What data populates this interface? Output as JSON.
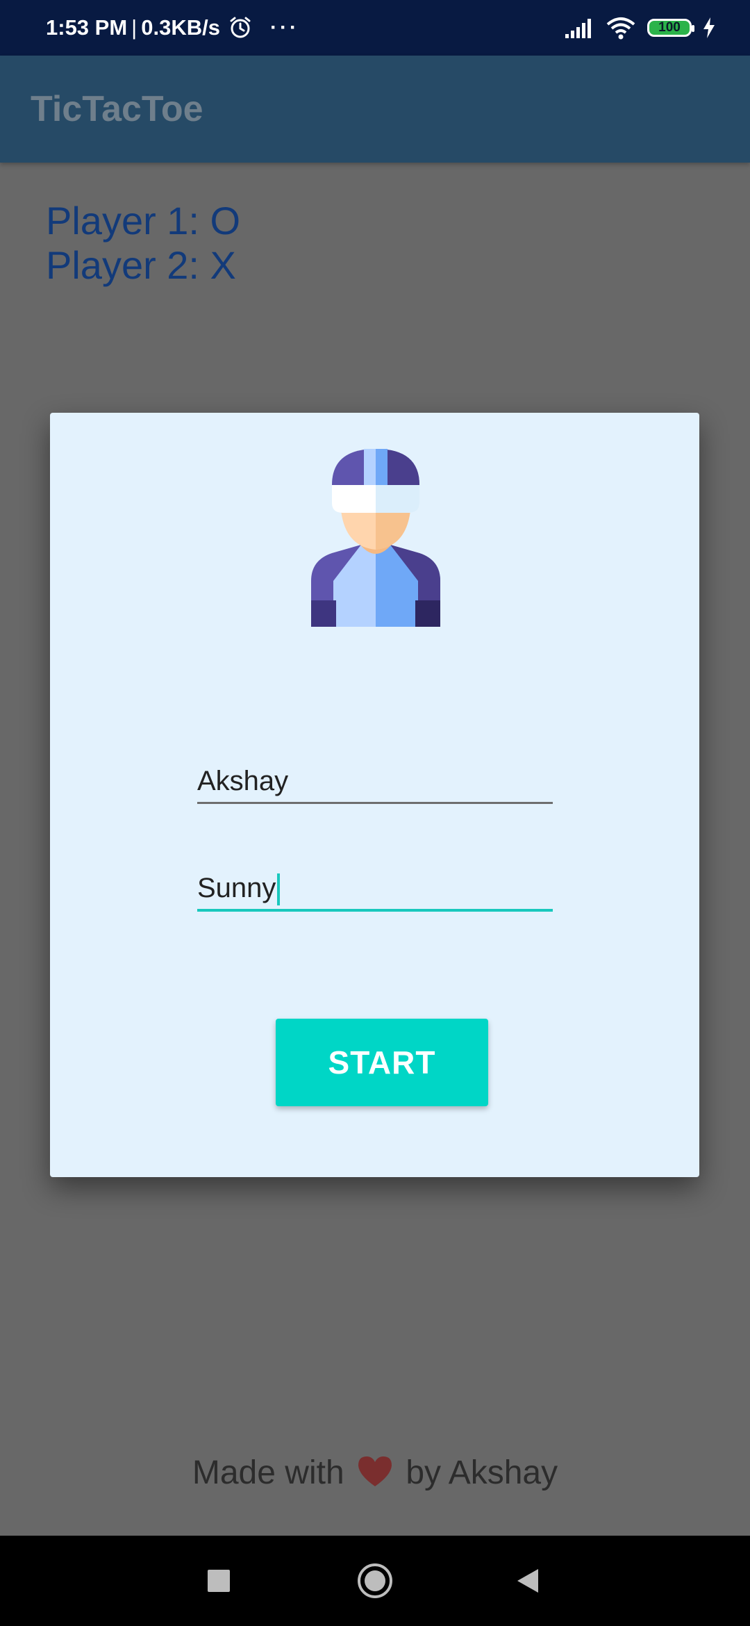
{
  "status_bar": {
    "time": "1:53 PM",
    "separator": "|",
    "speed": "0.3KB/s",
    "dots": "···",
    "battery": "100"
  },
  "app_bar": {
    "title": "TicTacToe"
  },
  "players": {
    "player1": "Player 1: O",
    "player2": "Player 2: X"
  },
  "dialog": {
    "player1_name": "Akshay",
    "player2_name": "Sunny",
    "start_label": "START"
  },
  "footer": {
    "prefix": "Made with",
    "suffix": "by Akshay"
  },
  "colors": {
    "accent": "#00d6c6",
    "dialog_bg": "#e3f2fd",
    "player_text": "#123a7a",
    "app_bar": "#264a66",
    "status_bar": "#081a42"
  }
}
